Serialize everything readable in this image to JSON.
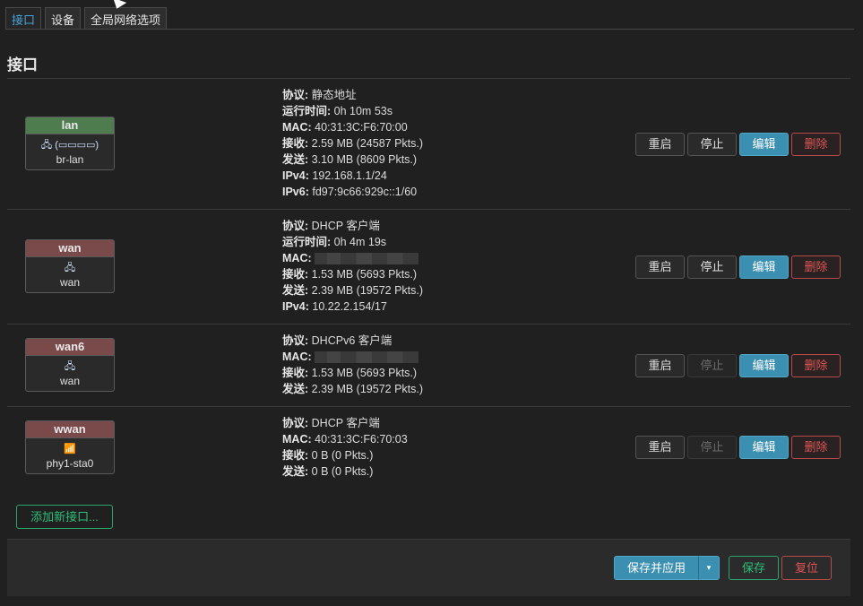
{
  "tabs": [
    "接口",
    "设备",
    "全局网络选项"
  ],
  "heading": "接口",
  "buttons": {
    "restart": "重启",
    "stop": "停止",
    "edit": "编辑",
    "delete": "删除"
  },
  "add_interface": "添加新接口...",
  "footer": {
    "save_apply": "保存并应用",
    "caret": "▾",
    "save": "保存",
    "reset": "复位"
  },
  "interfaces": [
    {
      "name": "lan",
      "name_color": "#4f7c4f",
      "icon": "🖧 (▭▭▭▭)",
      "device": "br-lan",
      "fields": [
        {
          "label": "协议:",
          "value": "静态地址"
        },
        {
          "label": "运行时间:",
          "value": "0h 10m 53s"
        },
        {
          "label": "MAC:",
          "value": "40:31:3C:F6:70:00"
        },
        {
          "label": "接收:",
          "value": "2.59 MB (24587 Pkts.)"
        },
        {
          "label": "发送:",
          "value": "3.10 MB (8609 Pkts.)"
        },
        {
          "label": "IPv4:",
          "value": "192.168.1.1/24"
        },
        {
          "label": "IPv6:",
          "value": "fd97:9c66:929c::1/60"
        }
      ],
      "stop_disabled": false
    },
    {
      "name": "wan",
      "name_color": "#7a4a4a",
      "icon": "🖧",
      "device": "wan",
      "fields": [
        {
          "label": "协议:",
          "value": "DHCP 客户端"
        },
        {
          "label": "运行时间:",
          "value": "0h 4m 19s"
        },
        {
          "label": "MAC:",
          "value": ""
        },
        {
          "label": "接收:",
          "value": "1.53 MB (5693 Pkts.)"
        },
        {
          "label": "发送:",
          "value": "2.39 MB (19572 Pkts.)"
        },
        {
          "label": "IPv4:",
          "value": "10.22.2.154/17"
        }
      ],
      "stop_disabled": false
    },
    {
      "name": "wan6",
      "name_color": "#7a4a4a",
      "icon": "🖧",
      "device": "wan",
      "fields": [
        {
          "label": "协议:",
          "value": "DHCPv6 客户端"
        },
        {
          "label": "MAC:",
          "value": ""
        },
        {
          "label": "接收:",
          "value": "1.53 MB (5693 Pkts.)"
        },
        {
          "label": "发送:",
          "value": "2.39 MB (19572 Pkts.)"
        }
      ],
      "stop_disabled": true
    },
    {
      "name": "wwan",
      "name_color": "#7a4a4a",
      "icon": "📶",
      "device": "phy1-sta0",
      "fields": [
        {
          "label": "协议:",
          "value": "DHCP 客户端"
        },
        {
          "label": "MAC:",
          "value": "40:31:3C:F6:70:03"
        },
        {
          "label": "接收:",
          "value": "0 B (0 Pkts.)"
        },
        {
          "label": "发送:",
          "value": "0 B (0 Pkts.)"
        }
      ],
      "stop_disabled": true
    }
  ]
}
